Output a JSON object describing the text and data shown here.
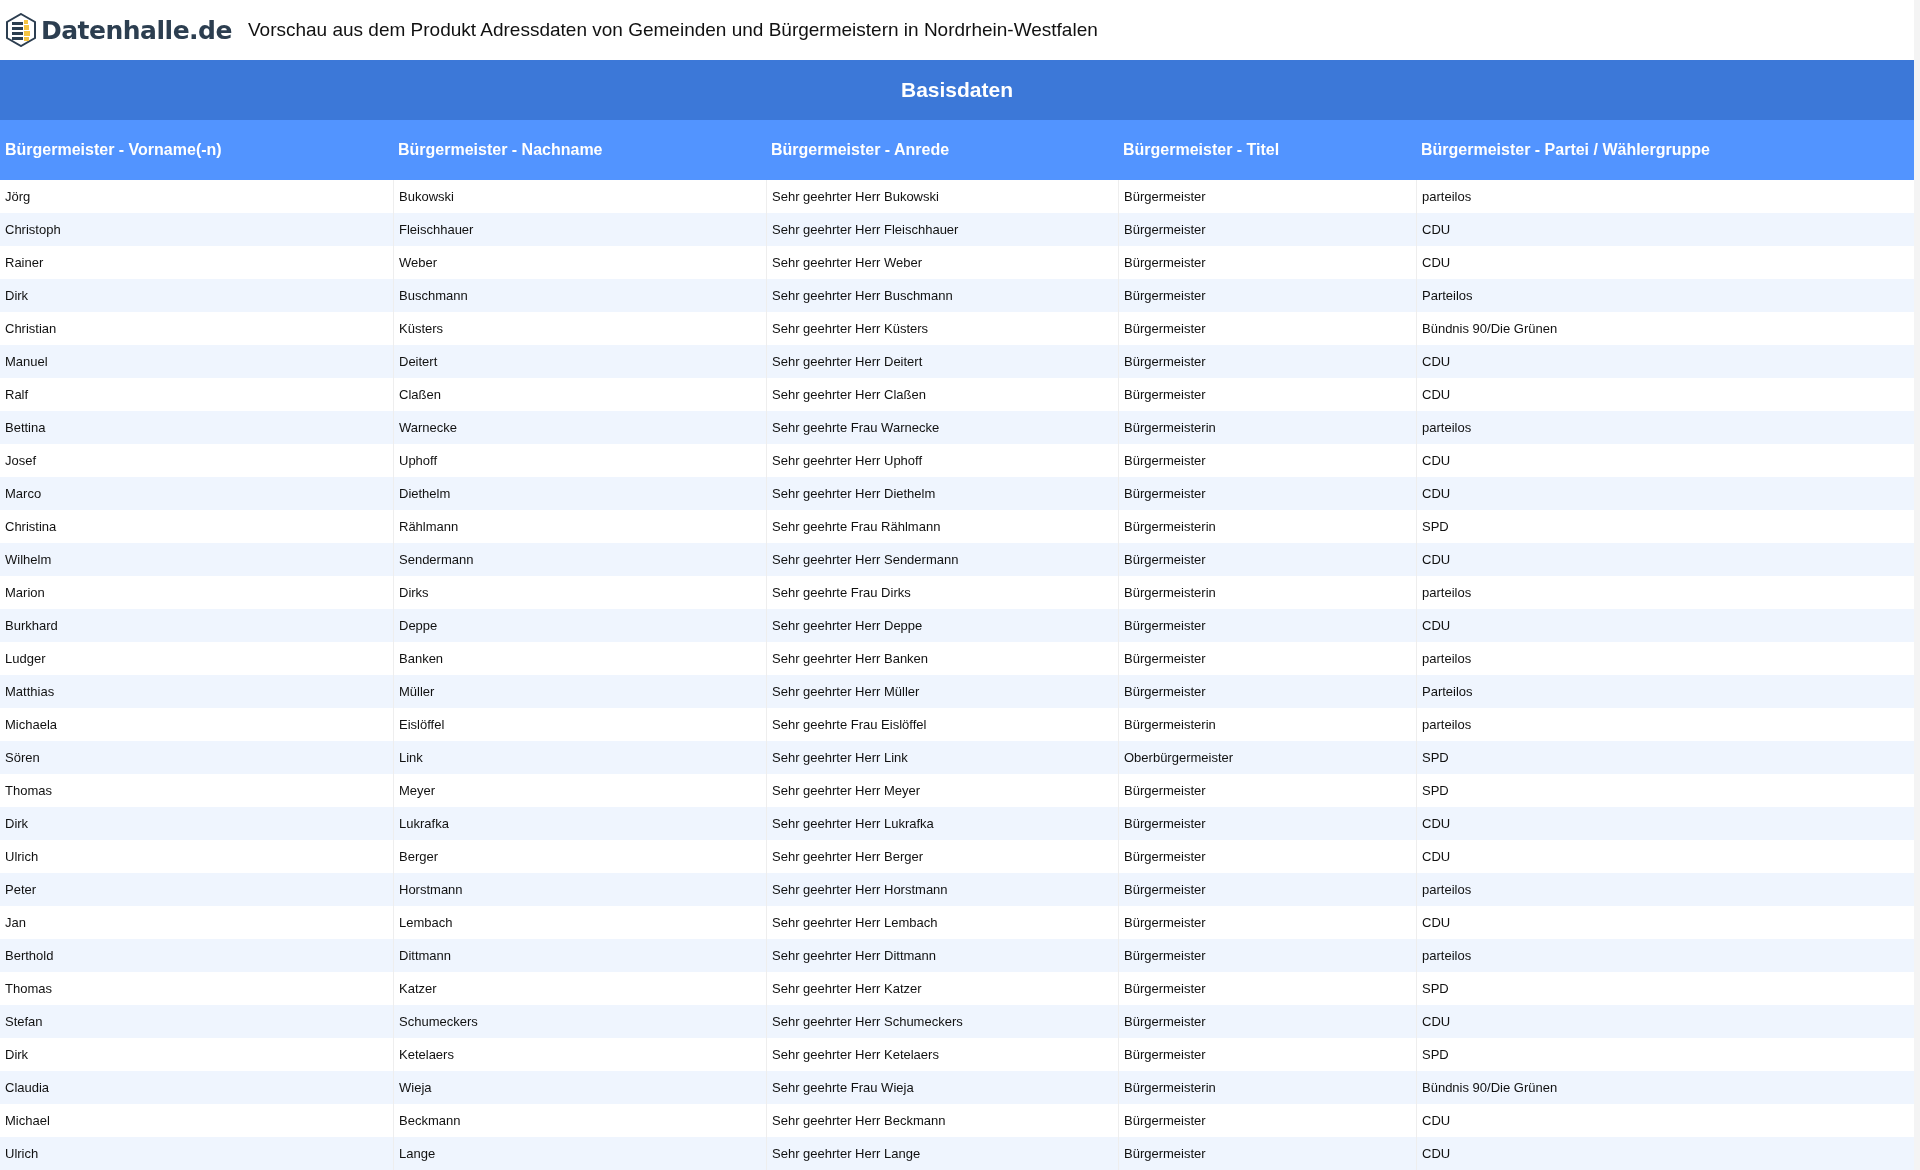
{
  "header": {
    "logo_text": "Datenhalle.de",
    "title": "Vorschau aus dem Produkt Adressdaten von Gemeinden und Bürgermeistern in Nordrhein-Westfalen"
  },
  "section_title": "Basisdaten",
  "table": {
    "columns": [
      "Bürgermeister - Vorname(-n)",
      "Bürgermeister - Nachname",
      "Bürgermeister - Anrede",
      "Bürgermeister - Titel",
      "Bürgermeister - Partei / Wählergruppe"
    ],
    "rows": [
      [
        "Jörg",
        "Bukowski",
        "Sehr geehrter Herr Bukowski",
        "Bürgermeister",
        "parteilos"
      ],
      [
        "Christoph",
        "Fleischhauer",
        "Sehr geehrter Herr Fleischhauer",
        "Bürgermeister",
        "CDU"
      ],
      [
        "Rainer",
        "Weber",
        "Sehr geehrter Herr Weber",
        "Bürgermeister",
        "CDU"
      ],
      [
        "Dirk",
        "Buschmann",
        "Sehr geehrter Herr Buschmann",
        "Bürgermeister",
        "Parteilos"
      ],
      [
        "Christian",
        "Küsters",
        "Sehr geehrter Herr Küsters",
        "Bürgermeister",
        "Bündnis 90/Die Grünen"
      ],
      [
        "Manuel",
        "Deitert",
        "Sehr geehrter Herr Deitert",
        "Bürgermeister",
        "CDU"
      ],
      [
        "Ralf",
        "Claßen",
        "Sehr geehrter Herr Claßen",
        "Bürgermeister",
        "CDU"
      ],
      [
        "Bettina",
        "Warnecke",
        "Sehr geehrte Frau Warnecke",
        "Bürgermeisterin",
        "parteilos"
      ],
      [
        "Josef",
        "Uphoff",
        "Sehr geehrter Herr Uphoff",
        "Bürgermeister",
        "CDU"
      ],
      [
        "Marco",
        "Diethelm",
        "Sehr geehrter Herr Diethelm",
        "Bürgermeister",
        "CDU"
      ],
      [
        "Christina",
        "Rählmann",
        "Sehr geehrte Frau Rählmann",
        "Bürgermeisterin",
        "SPD"
      ],
      [
        "Wilhelm",
        "Sendermann",
        "Sehr geehrter Herr Sendermann",
        "Bürgermeister",
        "CDU"
      ],
      [
        "Marion",
        "Dirks",
        "Sehr geehrte Frau Dirks",
        "Bürgermeisterin",
        "parteilos"
      ],
      [
        "Burkhard",
        "Deppe",
        "Sehr geehrter Herr Deppe",
        "Bürgermeister",
        "CDU"
      ],
      [
        "Ludger",
        "Banken",
        "Sehr geehrter Herr Banken",
        "Bürgermeister",
        "parteilos"
      ],
      [
        "Matthias",
        "Müller",
        "Sehr geehrter Herr Müller",
        "Bürgermeister",
        "Parteilos"
      ],
      [
        "Michaela",
        "Eislöffel",
        "Sehr geehrte Frau Eislöffel",
        "Bürgermeisterin",
        "parteilos"
      ],
      [
        "Sören",
        "Link",
        "Sehr geehrter Herr Link",
        "Oberbürgermeister",
        "SPD"
      ],
      [
        "Thomas",
        "Meyer",
        "Sehr geehrter Herr Meyer",
        "Bürgermeister",
        "SPD"
      ],
      [
        "Dirk",
        "Lukrafka",
        "Sehr geehrter Herr Lukrafka",
        "Bürgermeister",
        "CDU"
      ],
      [
        "Ulrich",
        "Berger",
        "Sehr geehrter Herr Berger",
        "Bürgermeister",
        "CDU"
      ],
      [
        "Peter",
        "Horstmann",
        "Sehr geehrter Herr Horstmann",
        "Bürgermeister",
        "parteilos"
      ],
      [
        "Jan",
        "Lembach",
        "Sehr geehrter Herr Lembach",
        "Bürgermeister",
        "CDU"
      ],
      [
        "Berthold",
        "Dittmann",
        "Sehr geehrter Herr Dittmann",
        "Bürgermeister",
        "parteilos"
      ],
      [
        "Thomas",
        "Katzer",
        "Sehr geehrter Herr Katzer",
        "Bürgermeister",
        "SPD"
      ],
      [
        "Stefan",
        "Schumeckers",
        "Sehr geehrter Herr Schumeckers",
        "Bürgermeister",
        "CDU"
      ],
      [
        "Dirk",
        "Ketelaers",
        "Sehr geehrter Herr Ketelaers",
        "Bürgermeister",
        "SPD"
      ],
      [
        "Claudia",
        "Wieja",
        "Sehr geehrte Frau Wieja",
        "Bürgermeisterin",
        "Bündnis 90/Die Grünen"
      ],
      [
        "Michael",
        "Beckmann",
        "Sehr geehrter Herr Beckmann",
        "Bürgermeister",
        "CDU"
      ],
      [
        "Ulrich",
        "Lange",
        "Sehr geehrter Herr Lange",
        "Bürgermeister",
        "CDU"
      ]
    ]
  }
}
